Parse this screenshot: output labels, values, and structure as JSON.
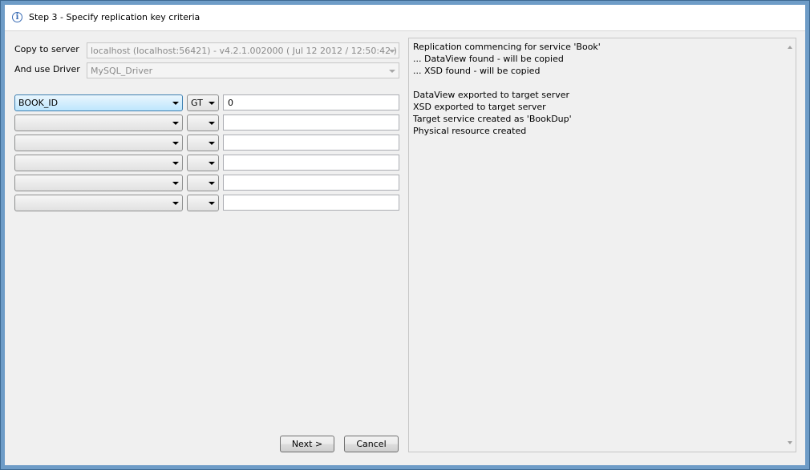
{
  "header": {
    "title": "Step 3 - Specify replication key criteria",
    "icon": "info-icon"
  },
  "form": {
    "server_label": "Copy to server",
    "server_value": "localhost (localhost:56421) - v4.2.1.002000 ( Jul 12 2012 / 12:50:42 )",
    "driver_label": "And use Driver",
    "driver_value": "MySQL_Driver"
  },
  "criteria_rows": [
    {
      "field": "BOOK_ID",
      "operator": "GT",
      "value": "0"
    },
    {
      "field": "",
      "operator": "",
      "value": ""
    },
    {
      "field": "",
      "operator": "",
      "value": ""
    },
    {
      "field": "",
      "operator": "",
      "value": ""
    },
    {
      "field": "",
      "operator": "",
      "value": ""
    },
    {
      "field": "",
      "operator": "",
      "value": ""
    }
  ],
  "log": {
    "lines": [
      "Replication commencing for service 'Book'",
      "... DataView found - will be copied",
      "... XSD found - will be copied",
      "",
      "DataView exported to target server",
      "XSD exported to target server",
      "Target service created as 'BookDup'",
      "Physical resource created"
    ]
  },
  "buttons": {
    "next": "Next >",
    "cancel": "Cancel"
  }
}
